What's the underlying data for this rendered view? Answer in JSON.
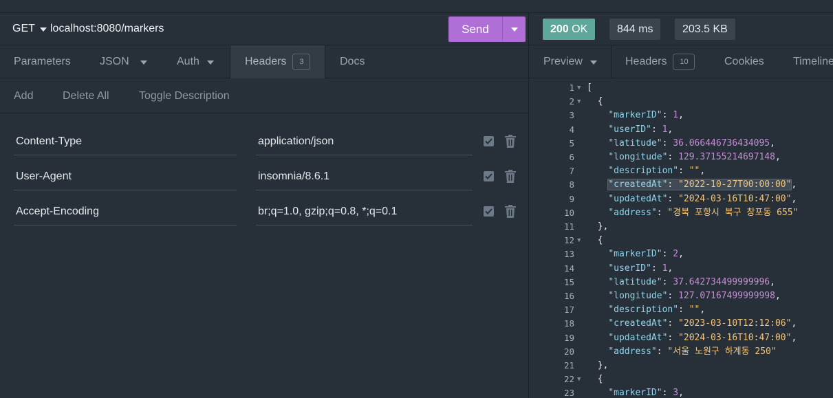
{
  "request": {
    "method": "GET",
    "url": "localhost:8080/markers",
    "send_label": "Send"
  },
  "request_tabs": [
    {
      "label": "Parameters"
    },
    {
      "label": "JSON"
    },
    {
      "label": "Auth"
    },
    {
      "label": "Headers",
      "badge": "3"
    },
    {
      "label": "Docs"
    }
  ],
  "header_actions": {
    "add": "Add",
    "delete_all": "Delete All",
    "toggle_description": "Toggle Description"
  },
  "headers": [
    {
      "name": "Content-Type",
      "value": "application/json",
      "enabled": true
    },
    {
      "name": "User-Agent",
      "value": "insomnia/8.6.1",
      "enabled": true
    },
    {
      "name": "Accept-Encoding",
      "value": "br;q=1.0, gzip;q=0.8, *;q=0.1",
      "enabled": true
    }
  ],
  "response": {
    "status_code": "200",
    "status_text": "OK",
    "time": "844 ms",
    "size": "203.5 KB"
  },
  "response_tabs": [
    {
      "label": "Preview"
    },
    {
      "label": "Headers",
      "badge": "10"
    },
    {
      "label": "Cookies"
    },
    {
      "label": "Timeline"
    }
  ],
  "preview_lines": [
    {
      "n": "1",
      "fold": true,
      "text": "["
    },
    {
      "n": "2",
      "fold": true,
      "text": "  {"
    },
    {
      "n": "3",
      "key": "markerID",
      "num": "1"
    },
    {
      "n": "4",
      "key": "userID",
      "num": "1"
    },
    {
      "n": "5",
      "key": "latitude",
      "num": "36.066446736434095"
    },
    {
      "n": "6",
      "key": "longitude",
      "num": "129.37155214697148"
    },
    {
      "n": "7",
      "key": "description",
      "str": "\"\""
    },
    {
      "n": "8",
      "key": "createdAt",
      "str": "\"2022-10-27T00:00:00\"",
      "highlight": true
    },
    {
      "n": "9",
      "key": "updatedAt",
      "str": "\"2024-03-16T10:47:00\""
    },
    {
      "n": "10",
      "key": "address",
      "str": "\"경북 포항시 북구 창포동 655\"",
      "last": true
    },
    {
      "n": "11",
      "text": "  },"
    },
    {
      "n": "12",
      "fold": true,
      "text": "  {"
    },
    {
      "n": "13",
      "key": "markerID",
      "num": "2"
    },
    {
      "n": "14",
      "key": "userID",
      "num": "1"
    },
    {
      "n": "15",
      "key": "latitude",
      "num": "37.642734499999996"
    },
    {
      "n": "16",
      "key": "longitude",
      "num": "127.07167499999998"
    },
    {
      "n": "17",
      "key": "description",
      "str": "\"\""
    },
    {
      "n": "18",
      "key": "createdAt",
      "str": "\"2023-03-10T12:12:06\""
    },
    {
      "n": "19",
      "key": "updatedAt",
      "str": "\"2024-03-16T10:47:00\""
    },
    {
      "n": "20",
      "key": "address",
      "str": "\"서울 노원구 하계동 250\"",
      "last": true
    },
    {
      "n": "21",
      "text": "  },"
    },
    {
      "n": "22",
      "fold": true,
      "text": "  {"
    },
    {
      "n": "23",
      "key": "markerID",
      "num": "3"
    }
  ],
  "colors": {
    "accent_send": "#b06fd6",
    "status_ok": "#5fa79a",
    "json_key": "#8fd6ee",
    "json_number": "#c78fd6",
    "json_string": "#f3c47a"
  }
}
